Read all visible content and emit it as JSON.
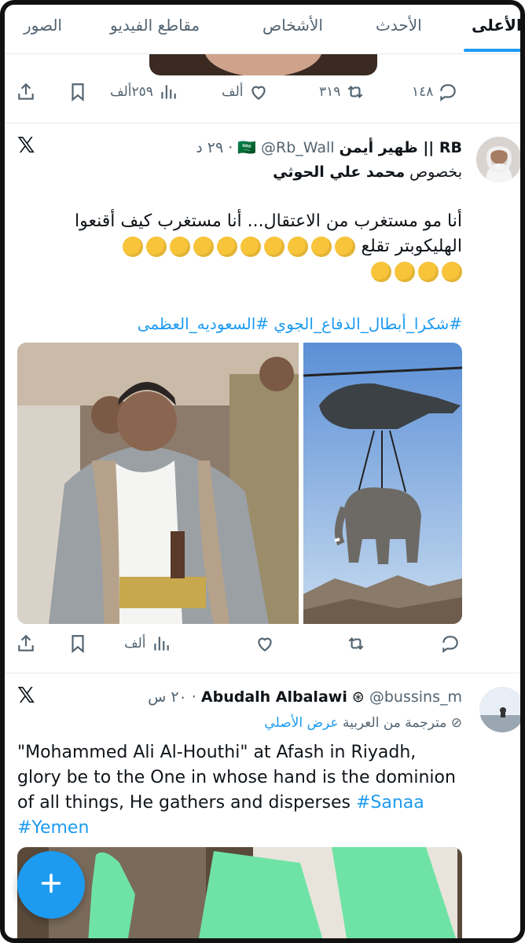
{
  "tabs": [
    "الأعلى",
    "الأحدث",
    "الأشخاص",
    "مقاطع الفيديو",
    "الصور"
  ],
  "active_tab": "الأعلى",
  "prev_post": {
    "replies": "١٤٨",
    "retweets": "٣١٩",
    "likes": "ألف",
    "views": "٢٥٩ألف"
  },
  "post1": {
    "name": "RB || ظهير أيمن",
    "flag": "🇸🇦",
    "handle": "@Rb_Wall",
    "dot": "·",
    "time": "٢٩ د",
    "reply_prefix": "بخصوص",
    "reply_to": "محمد علي الحوثي",
    "text_line1": "أنا مو مستغرب من الاعتقال... أنا مستغرب كيف أقنعوا",
    "text_line2": "الهليكوبتر تقلع",
    "hashtags": "#شكرا_أبطال_الدفاع_الجوي #السعوديه_العظمى",
    "views": "ألف"
  },
  "post2": {
    "name": "Abudalh Albalawi",
    "handle": "@bussins_m",
    "dot": "·",
    "time": "٢٠ س",
    "translated_label": "مترجمة من العربية",
    "show_original": "عرض الأصلي",
    "text_line1": "\"Mohammed Ali Al-Houthi\" at Afash in Riyadh,",
    "text_line2": "glory be to the One in whose hand is the dominion",
    "text_line3": "of all things, He gathers and disperses",
    "hashtag1": "#Sanaa",
    "hashtag2": "#Yemen"
  },
  "colors": {
    "accent": "#1d9bf0",
    "muted": "#536471",
    "text": "#0f1419"
  }
}
